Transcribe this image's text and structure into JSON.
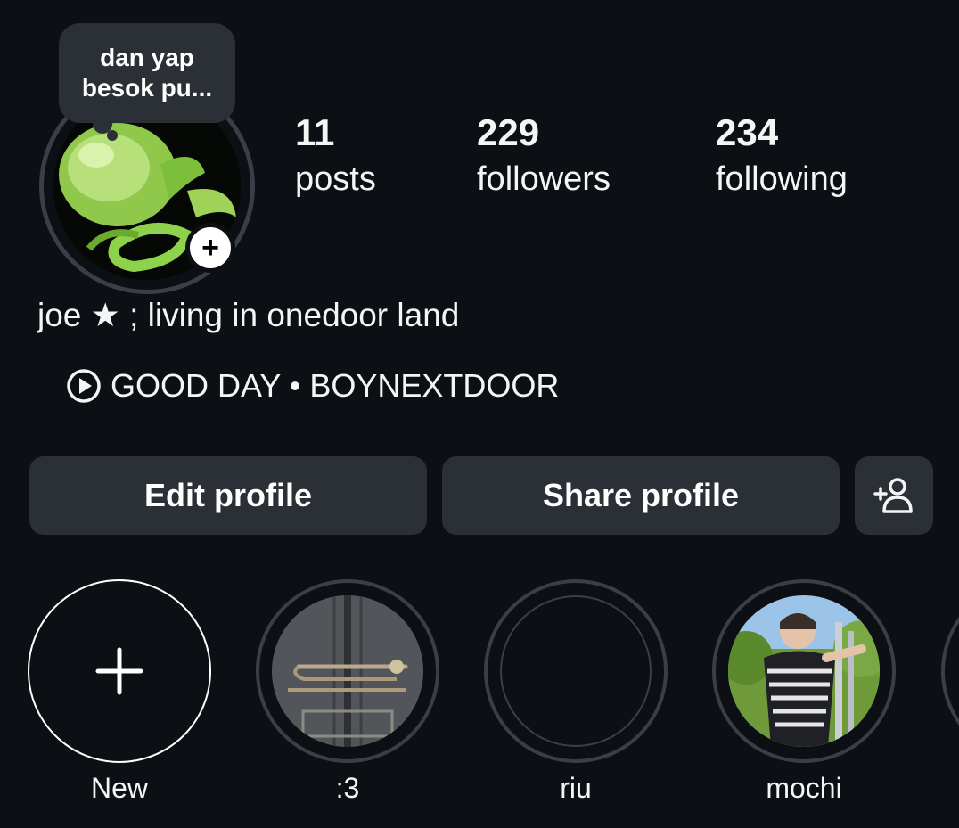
{
  "note": {
    "line1": "dan yap",
    "line2": "besok pu..."
  },
  "avatar": {
    "badge_icon": "plus-icon"
  },
  "stats": {
    "posts": {
      "count": "11",
      "label": "posts"
    },
    "followers": {
      "count": "229",
      "label": "followers"
    },
    "following": {
      "count": "234",
      "label": "following"
    }
  },
  "bio": {
    "name": "joe ★ ; living in onedoor land",
    "music": "GOOD DAY • BOYNEXTDOOR"
  },
  "buttons": {
    "edit": "Edit profile",
    "share": "Share profile",
    "add_user_icon": "add-person-icon"
  },
  "highlights": [
    {
      "label": "New"
    },
    {
      "label": ":3"
    },
    {
      "label": "riu"
    },
    {
      "label": "mochi"
    }
  ],
  "colors": {
    "background": "#0c0f14",
    "button": "#2b2f36",
    "ring": "#3a3f46"
  }
}
